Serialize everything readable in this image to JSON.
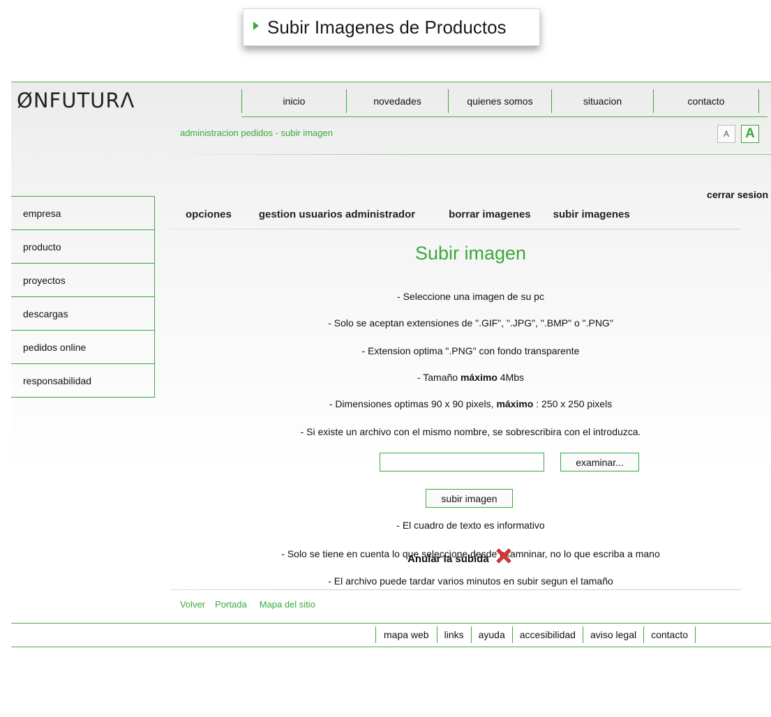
{
  "caption": {
    "text": "Subir Imagenes de Productos"
  },
  "logo": {
    "text": "ØNFUTURΛ"
  },
  "topnav": {
    "items": [
      "inicio",
      "novedades",
      "quienes somos",
      "situacion",
      "contacto"
    ]
  },
  "breadcrumb": "administracion pedidos - subir imagen",
  "font_controls": {
    "decrease": "A",
    "increase": "A"
  },
  "logout": "cerrar sesion",
  "sidebar": {
    "items": [
      "empresa",
      "producto",
      "proyectos",
      "descargas",
      "pedidos online",
      "responsabilidad"
    ]
  },
  "options": {
    "items": [
      "opciones",
      "gestion usuarios administrador",
      "borrar imagenes",
      "subir imagenes"
    ]
  },
  "upload": {
    "title": "Subir imagen",
    "line1": "- Seleccione una imagen de su pc",
    "line2": "- Solo se aceptan extensiones de \".GIF\", \".JPG\", \".BMP\" o \".PNG\"",
    "line3": "- Extension optima \".PNG\" con fondo transparente",
    "line4_pre": "- Tamaño ",
    "line4_bold": "máximo",
    "line4_post": " 4Mbs",
    "line5_pre": "- Dimensiones optimas 90 x 90 pixels, ",
    "line5_bold": "máximo",
    "line5_post": " : 250 x 250 pixels",
    "line6": "- Si existe un archivo con el mismo nombre, se sobrescribira con el introduzca.",
    "file_value": "",
    "browse_label": "examinar...",
    "submit_label": "subir imagen",
    "note1": "- El cuadro de texto es informativo",
    "note2": "- Solo se tiene en cuenta lo que seleccione desde examninar, no lo que escriba a mano",
    "note3": "- El archivo puede tardar varios minutos en subir segun el tamaño",
    "cancel_label": "Anular la subida",
    "cancel_icon": "red-x-icon"
  },
  "footer_links": [
    "Volver",
    "Portada",
    "Mapa del sitio"
  ],
  "footer_nav": [
    "mapa web",
    "links",
    "ayuda",
    "accesibilidad",
    "aviso legal",
    "contacto"
  ],
  "colors": {
    "accent": "#3aa83a",
    "cancel_red": "#e0383a"
  }
}
